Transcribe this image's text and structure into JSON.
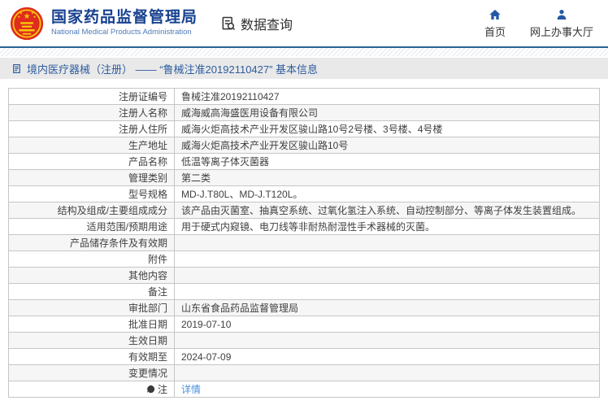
{
  "header": {
    "logo": {
      "title_zh": "国家药品监督管理局",
      "title_en": "National Medical Products Administration",
      "emblem_icon": "china-national-emblem-icon"
    },
    "data_query": {
      "label": "数据查询",
      "icon": "document-search-icon"
    },
    "nav": {
      "home": {
        "label": "首页",
        "icon": "home-icon"
      },
      "service_hall": {
        "label": "网上办事大厅",
        "icon": "person-icon"
      }
    }
  },
  "breadcrumb": {
    "icon": "document-icon",
    "title": "境内医疗器械（注册） —— “鲁械注准20192110427” 基本信息"
  },
  "table": {
    "rows": [
      {
        "label": "注册证编号",
        "value": "鲁械注准20192110427"
      },
      {
        "label": "注册人名称",
        "value": "威海威高海盛医用设备有限公司"
      },
      {
        "label": "注册人住所",
        "value": "威海火炬高技术产业开发区骏山路10号2号楼、3号楼、4号楼"
      },
      {
        "label": "生产地址",
        "value": "威海火炬高技术产业开发区骏山路10号"
      },
      {
        "label": "产品名称",
        "value": "低温等离子体灭菌器"
      },
      {
        "label": "管理类别",
        "value": "第二类"
      },
      {
        "label": "型号规格",
        "value": "MD-J.T80L、MD-J.T120L。"
      },
      {
        "label": "结构及组成/主要组成成分",
        "value": "该产品由灭菌室、抽真空系统、过氧化氢注入系统、自动控制部分、等离子体发生装置组成。"
      },
      {
        "label": "适用范围/预期用途",
        "value": "用于硬式内窥镜、电刀线等非耐热耐湿性手术器械的灭菌。"
      },
      {
        "label": "产品储存条件及有效期",
        "value": ""
      },
      {
        "label": "附件",
        "value": ""
      },
      {
        "label": "其他内容",
        "value": ""
      },
      {
        "label": "备注",
        "value": ""
      },
      {
        "label": "审批部门",
        "value": "山东省食品药品监督管理局"
      },
      {
        "label": "批准日期",
        "value": "2019-07-10"
      },
      {
        "label": "生效日期",
        "value": ""
      },
      {
        "label": "有效期至",
        "value": "2024-07-09"
      },
      {
        "label": "变更情况",
        "value": ""
      },
      {
        "label": "注",
        "value": "详情"
      }
    ],
    "note_row_icon": "comment-icon"
  },
  "colors": {
    "brand_blue": "#17418f",
    "brand_blue_light": "#4f7ab8",
    "header_border": "#2a6496",
    "nav_icon_blue": "#2458a6",
    "titlebar_bg": "#e9e9e9",
    "titlebar_text": "#2d5c9e",
    "table_border": "#c6c6c6",
    "row_stripe": "#f6f6f6",
    "body_text": "#3f3f3f",
    "link": "#4a90d9",
    "emblem_red": "#e02c1d",
    "emblem_gold": "#f9cc0b"
  }
}
